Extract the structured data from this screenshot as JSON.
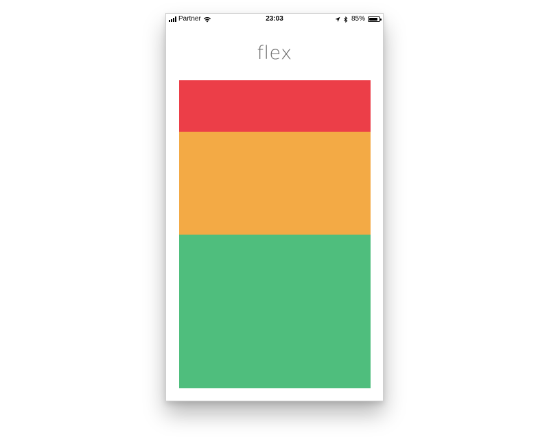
{
  "status_bar": {
    "carrier": "Partner",
    "time": "23:03",
    "battery_percent": "85%",
    "battery_level": 0.85,
    "icons": [
      "signal-icon",
      "wifi-icon",
      "location-arrow-icon",
      "bluetooth-icon",
      "battery-icon"
    ]
  },
  "screen": {
    "title": "flex"
  },
  "flex_boxes": [
    {
      "name": "red-box",
      "color": "#ec3e48",
      "flex": 1
    },
    {
      "name": "orange-box",
      "color": "#f3aa45",
      "flex": 2
    },
    {
      "name": "green-box",
      "color": "#4fbe7d",
      "flex": 3
    }
  ]
}
